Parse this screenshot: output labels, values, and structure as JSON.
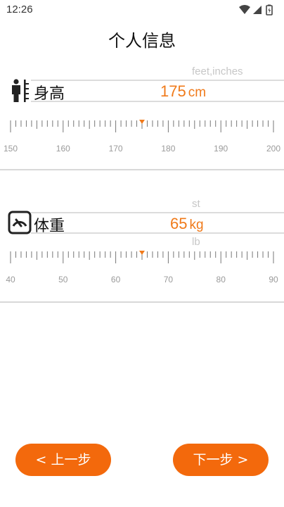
{
  "status": {
    "time": "12:26"
  },
  "title": "个人信息",
  "height": {
    "label": "身高",
    "value": "175",
    "unit": "cm",
    "alt_unit": "feet,inches",
    "ruler": {
      "min": 150,
      "max": 200,
      "current": 175,
      "labels": [
        "150",
        "160",
        "170",
        "180",
        "190",
        "200"
      ]
    }
  },
  "weight": {
    "label": "体重",
    "value": "65",
    "unit": "kg",
    "alt_unit_top": "st",
    "alt_unit_bottom": "lb",
    "ruler": {
      "min": 40,
      "max": 90,
      "current": 65,
      "labels": [
        "40",
        "50",
        "60",
        "70",
        "80",
        "90"
      ]
    }
  },
  "nav": {
    "prev": "< 上一步",
    "next": "下一步 >"
  },
  "colors": {
    "accent": "#f07a1a",
    "button": "#f3690c"
  }
}
